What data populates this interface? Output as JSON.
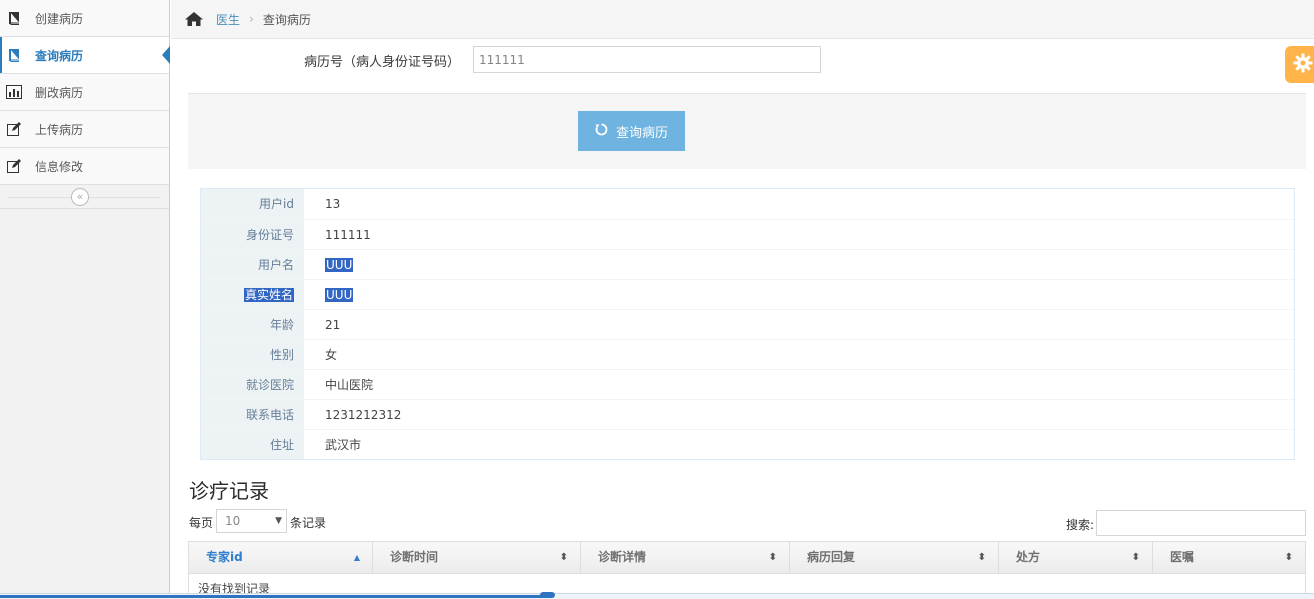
{
  "sidebar": {
    "items": [
      {
        "label": "创建病历",
        "icon": "book-icon"
      },
      {
        "label": "查询病历",
        "icon": "book-icon"
      },
      {
        "label": "删改病历",
        "icon": "bar-chart-icon"
      },
      {
        "label": "上传病历",
        "icon": "edit-icon"
      },
      {
        "label": "信息修改",
        "icon": "edit-icon"
      }
    ],
    "active_index": 1,
    "collapse_symbol": "«"
  },
  "breadcrumbs": {
    "home_icon": "home-icon",
    "link": "医生",
    "separator": "›",
    "current": "查询病历"
  },
  "settings_icon": "gear-icon",
  "search_form": {
    "label": "病历号（病人身份证号码）",
    "value": "111111",
    "button_label": "查询病历",
    "button_icon": "undo-icon"
  },
  "profile": {
    "rows": [
      {
        "name": "用户id",
        "value": "13"
      },
      {
        "name": "身份证号",
        "value": "111111"
      },
      {
        "name": "用户名",
        "value": "UUU"
      },
      {
        "name": "真实姓名",
        "value": "UUU"
      },
      {
        "name": "年龄",
        "value": "21"
      },
      {
        "name": "性别",
        "value": "女"
      },
      {
        "name": "就诊医院",
        "value": "中山医院"
      },
      {
        "name": "联系电话",
        "value": "1231212312"
      },
      {
        "name": "住址",
        "value": "武汉市"
      }
    ]
  },
  "records": {
    "title": "诊疗记录",
    "length_prefix": "每页",
    "length_value": "10",
    "length_suffix": "条记录",
    "search_label": "搜索:",
    "columns": [
      "专家id",
      "诊断时间",
      "诊断详情",
      "病历回复",
      "处方",
      "医嘱"
    ],
    "sorted_column": 0,
    "empty_text": "没有找到记录"
  },
  "colors": {
    "accent": "#2b7dbc",
    "button": "#6fb3e0",
    "settings": "#ffb44b",
    "selection": "#3166c4"
  }
}
